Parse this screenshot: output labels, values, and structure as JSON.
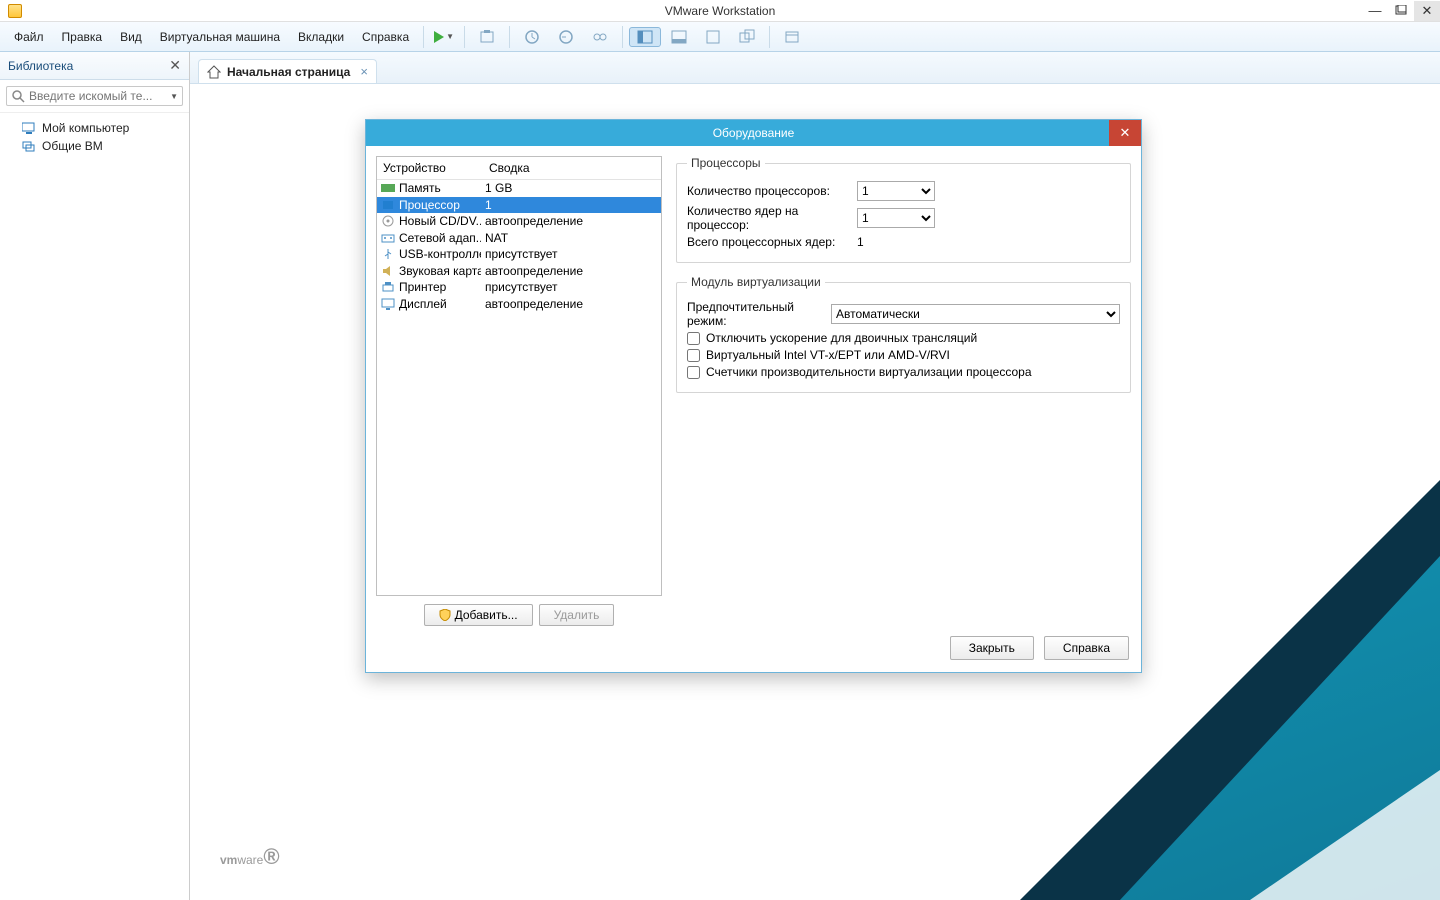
{
  "window": {
    "title": "VMware Workstation"
  },
  "menu": {
    "items": [
      "Файл",
      "Правка",
      "Вид",
      "Виртуальная машина",
      "Вкладки",
      "Справка"
    ]
  },
  "sidebar": {
    "title": "Библиотека",
    "search_placeholder": "Введите искомый те...",
    "items": [
      {
        "label": "Мой компьютер"
      },
      {
        "label": "Общие ВМ"
      }
    ]
  },
  "tab": {
    "label": "Начальная страница"
  },
  "logo": {
    "part1": "vm",
    "part2": "ware"
  },
  "dialog": {
    "title": "Оборудование",
    "columns": {
      "device": "Устройство",
      "summary": "Сводка"
    },
    "devices": [
      {
        "name": "Память",
        "summary": "1 GB",
        "icon": "mem"
      },
      {
        "name": "Процессор",
        "summary": "1",
        "icon": "cpu",
        "selected": true
      },
      {
        "name": "Новый CD/DV...",
        "summary": "автоопределение",
        "icon": "cd"
      },
      {
        "name": "Сетевой адап...",
        "summary": "NAT",
        "icon": "net"
      },
      {
        "name": "USB-контроллер",
        "summary": "присутствует",
        "icon": "usb"
      },
      {
        "name": "Звуковая карта",
        "summary": "автоопределение",
        "icon": "snd"
      },
      {
        "name": "Принтер",
        "summary": "присутствует",
        "icon": "prn"
      },
      {
        "name": "Дисплей",
        "summary": "автоопределение",
        "icon": "dsp"
      }
    ],
    "add_button": "Добавить...",
    "remove_button": "Удалить",
    "processors": {
      "legend": "Процессоры",
      "count_label": "Количество процессоров:",
      "count_value": "1",
      "cores_label": "Количество ядер на процессор:",
      "cores_value": "1",
      "total_label": "Всего процессорных ядер:",
      "total_value": "1"
    },
    "virt": {
      "legend": "Модуль виртуализации",
      "mode_label": "Предпочтительный режим:",
      "mode_value": "Автоматически",
      "chk_disable_accel": "Отключить ускорение для двоичных трансляций",
      "chk_vtx": "Виртуальный Intel VT-x/EPT или AMD-V/RVI",
      "chk_perfcounters": "Счетчики производительности виртуализации процессора"
    },
    "close_button": "Закрыть",
    "help_button": "Справка"
  }
}
